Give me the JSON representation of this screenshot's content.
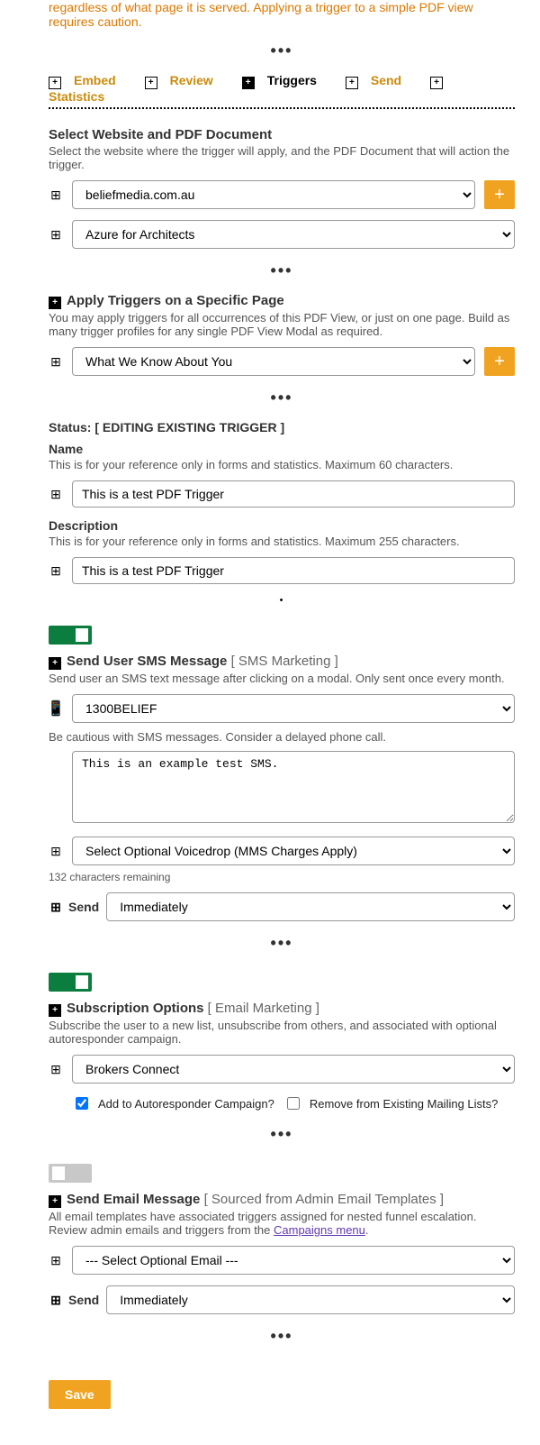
{
  "intro_tail": "regardless of what page it is served. Applying a trigger to a simple PDF view requires caution.",
  "tabs": {
    "embed": "Embed",
    "review": "Review",
    "triggers": "Triggers",
    "send": "Send",
    "statistics": "Statistics"
  },
  "site_section": {
    "title": "Select Website and PDF Document",
    "desc": "Select the website where the trigger will apply, and the PDF Document that will action the trigger.",
    "website": "beliefmedia.com.au",
    "pdf": "Azure for Architects"
  },
  "page_section": {
    "title": "Apply Triggers on a Specific Page",
    "desc": "You may apply triggers for all occurrences of this PDF View, or just on one page. Build as many trigger profiles for any single PDF View Modal as required.",
    "page": "What We Know About You"
  },
  "status": {
    "label": "Status:",
    "value": "[ EDITING EXISTING TRIGGER ]"
  },
  "name": {
    "title": "Name",
    "desc": "This is for your reference only in forms and statistics. Maximum 60 characters.",
    "value": "This is a test PDF Trigger"
  },
  "description": {
    "title": "Description",
    "desc": "This is for your reference only in forms and statistics. Maximum 255 characters.",
    "value": "This is a test PDF Trigger"
  },
  "sms": {
    "title": "Send User SMS Message",
    "bracket": "[ SMS Marketing ]",
    "desc": "Send user an SMS text message after clicking on a modal. Only sent once every month.",
    "from": "1300BELIEF",
    "caution": "Be cautious with SMS messages. Consider a delayed phone call.",
    "body": "This is an example test SMS.",
    "voicedrop": "Select Optional Voicedrop (MMS Charges Apply)",
    "remaining": "132 characters remaining",
    "send_label": "Send",
    "send_value": "Immediately"
  },
  "subscribe": {
    "title": "Subscription Options",
    "bracket": "[ Email Marketing ]",
    "desc": "Subscribe the user to a new list, unsubscribe from others, and associated with optional autoresponder campaign.",
    "list": "Brokers Connect",
    "opt_autoresponder": "Add to Autoresponder Campaign?",
    "opt_remove": "Remove from Existing Mailing Lists?"
  },
  "email": {
    "title": "Send Email Message",
    "bracket": "[ Sourced from Admin Email Templates ]",
    "desc_pre": "All email templates have associated triggers assigned for nested funnel escalation. Review admin emails and triggers from the ",
    "desc_link": "Campaigns menu",
    "desc_post": ".",
    "select": "--- Select Optional Email ---",
    "send_label": "Send",
    "send_value": "Immediately"
  },
  "save": "Save"
}
